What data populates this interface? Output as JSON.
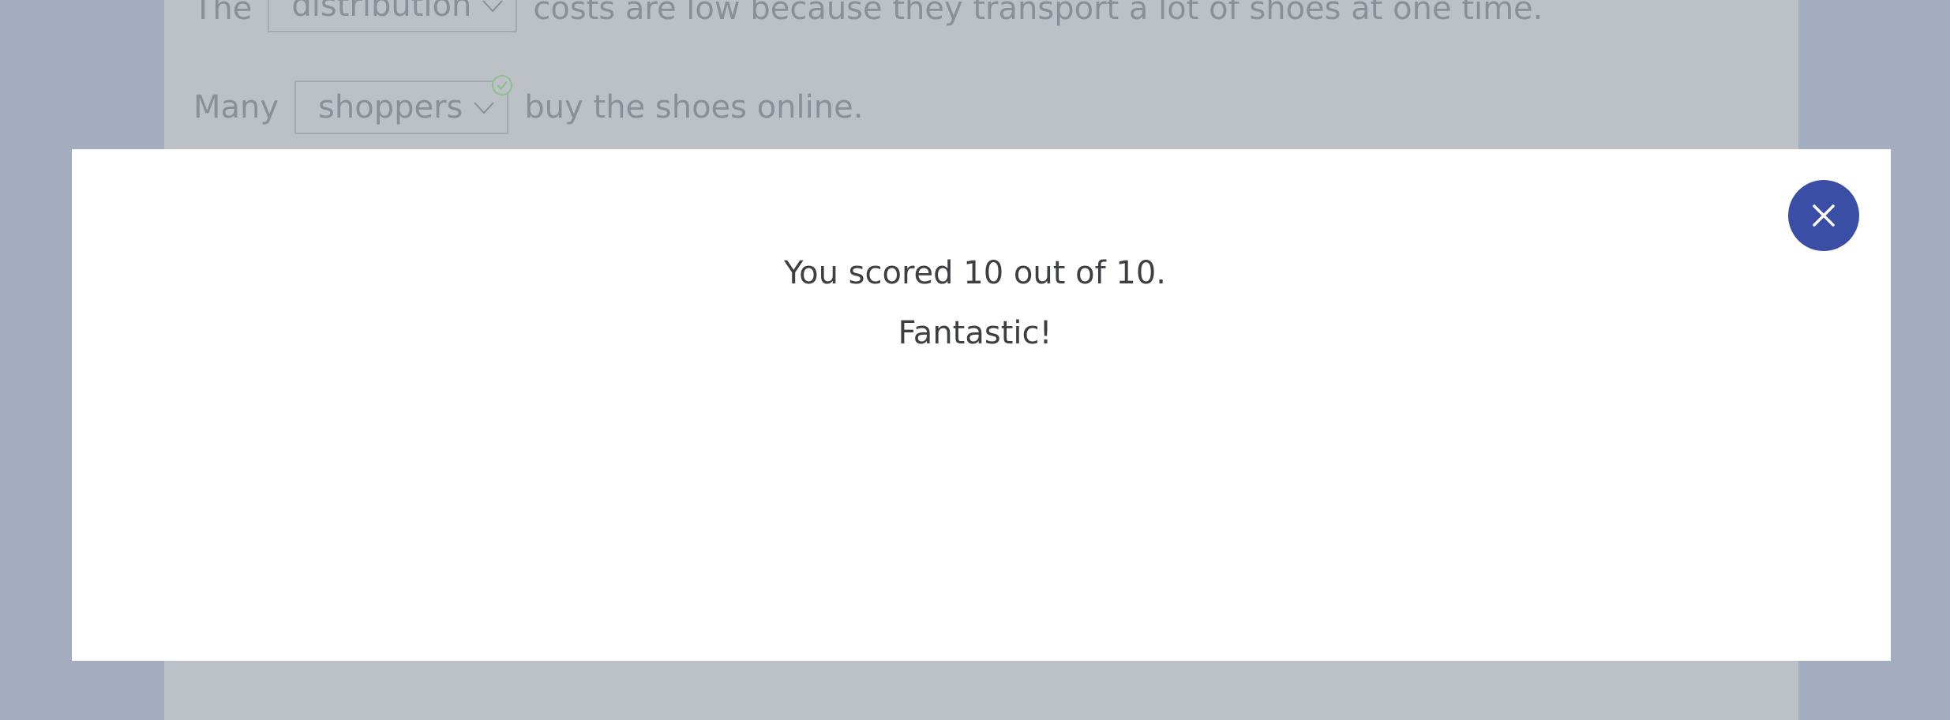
{
  "background": {
    "sentence_1": {
      "prefix": "The",
      "dropdown_value": "distribution",
      "suffix": "costs are low because they transport a lot of shoes at one time."
    },
    "sentence_2": {
      "prefix": "Many",
      "dropdown_value": "shoppers",
      "suffix": "buy the shoes online.",
      "status": "correct"
    }
  },
  "modal": {
    "score_text": "You scored 10 out of 10.",
    "praise_text": "Fantastic!",
    "close_icon": "close-icon"
  },
  "colors": {
    "overlay": "#a4adc0",
    "page": "#bcc1c8",
    "accent": "#3b4ea6",
    "check": "#8cc08c"
  }
}
